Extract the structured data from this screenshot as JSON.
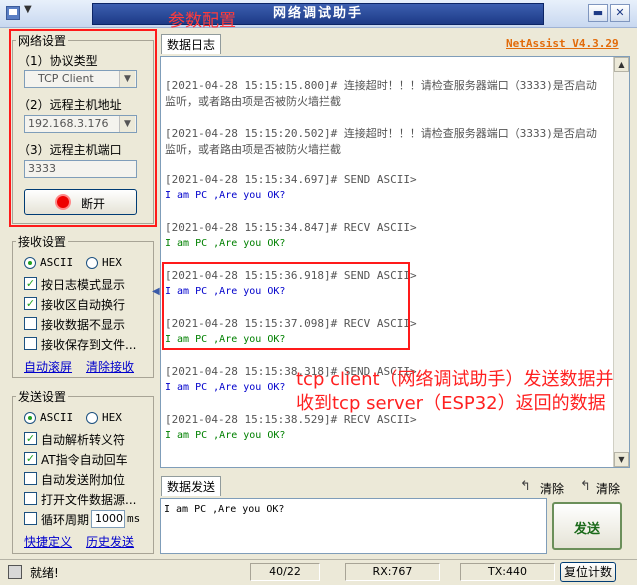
{
  "window": {
    "title": "网络调试助手",
    "min_glyph": "▬",
    "close_glyph": "✕",
    "brand": "NetAssist V4.3.29"
  },
  "annotations": {
    "params_label": "参数配置",
    "description": "tcp client（网络调试助手）发送数据并收到tcp server（ESP32）返回的数据",
    "color": "#ff1a1a"
  },
  "network": {
    "group_label": "网络设置",
    "protocol_label": "（1）协议类型",
    "protocol_value": "TCP Client",
    "host_label": "（2）远程主机地址",
    "host_value": "192.168.3.176",
    "port_label": "（3）远程主机端口",
    "port_value": "3333",
    "disconnect_label": "断开"
  },
  "receive": {
    "group_label": "接收设置",
    "ascii_label": "ASCII",
    "hex_label": "HEX",
    "opt_log_mode": "按日志模式显示",
    "opt_auto_wrap": "接收区自动换行",
    "opt_hide": "接收数据不显示",
    "opt_save_file": "接收保存到文件...",
    "auto_scroll": "自动滚屏",
    "clear_recv": "清除接收"
  },
  "send": {
    "group_label": "发送设置",
    "ascii_label": "ASCII",
    "hex_label": "HEX",
    "opt_escape": "自动解析转义符",
    "opt_at_crlf": "AT指令自动回车",
    "opt_append": "自动发送附加位",
    "opt_file_source": "打开文件数据源...",
    "opt_cycle": "循环周期",
    "cycle_value": "1000",
    "cycle_unit": "ms",
    "shortcut": "快捷定义",
    "history": "历史发送",
    "tab_label": "数据发送",
    "clear1": "清除",
    "clear2": "清除",
    "input_value": "I am PC ,Are you OK?",
    "send_button": "发送"
  },
  "log": {
    "tab_label": "数据日志",
    "entries": [
      {
        "ts": "[2021-04-28 15:15:15.800]#",
        "text": "连接超时！！！请检查服务器端口（3333)是否启动",
        "text2": "监听，或者路由项是否被防火墙拦截"
      },
      {
        "ts": "[2021-04-28 15:15:20.502]#",
        "text": "连接超时！！！请检查服务器端口（3333)是否启动",
        "text2": "监听，或者路由项是否被防火墙拦截"
      },
      {
        "ts": "[2021-04-28 15:15:34.697]#",
        "kind": "SEND ASCII>",
        "data": "I am PC ,Are you OK?"
      },
      {
        "ts": "[2021-04-28 15:15:34.847]#",
        "kind": "RECV ASCII>",
        "data": "I am PC ,Are you OK?"
      },
      {
        "ts": "[2021-04-28 15:15:36.918]#",
        "kind": "SEND ASCII>",
        "data": "I am PC ,Are you OK?"
      },
      {
        "ts": "[2021-04-28 15:15:37.098]#",
        "kind": "RECV ASCII>",
        "data": "I am PC ,Are you OK?"
      },
      {
        "ts": "[2021-04-28 15:15:38.318]#",
        "kind": "SEND ASCII>",
        "data": "I am PC ,Are you OK?"
      },
      {
        "ts": "[2021-04-28 15:15:38.529]#",
        "kind": "RECV ASCII>",
        "data": "I am PC ,Are you OK?"
      }
    ]
  },
  "status": {
    "ready": "就绪!",
    "ratio": "40/22",
    "rx": "RX:767",
    "tx": "TX:440",
    "reset": "复位计数"
  }
}
